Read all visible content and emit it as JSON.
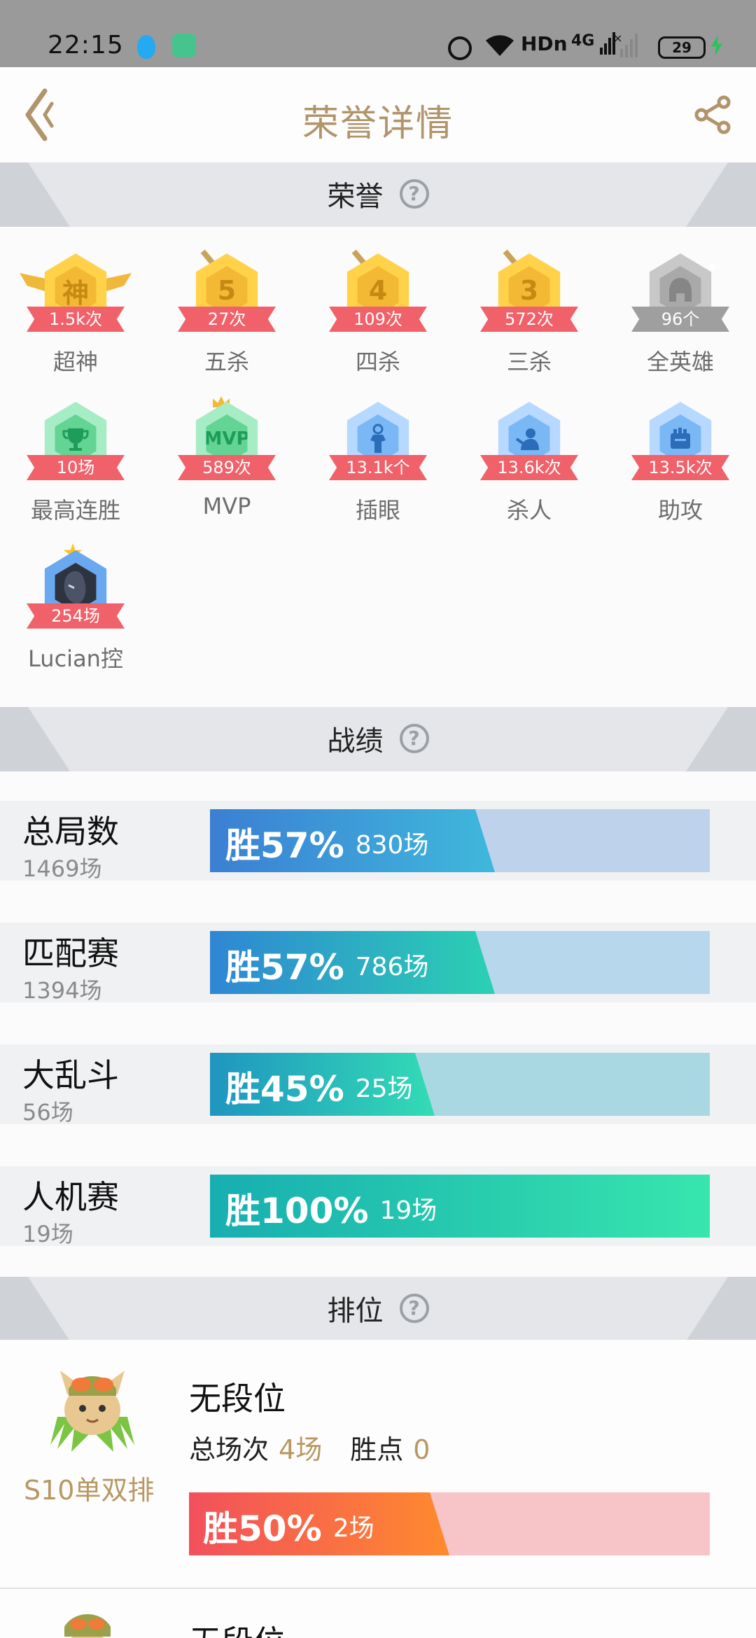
{
  "status_bar": {
    "time": "22:15",
    "icons": [
      "qq-icon",
      "app-icon",
      "alarm-icon",
      "wifi-icon",
      "hd-icon",
      "signal-4g-icon",
      "signal-icon",
      "battery-icon",
      "charging-icon"
    ],
    "hd": "HDn",
    "network": "4G",
    "battery": "29"
  },
  "header": {
    "title": "荣誉详情",
    "back_icon": "chevron-left-icon",
    "share_icon": "share-icon",
    "accent": "#b0946a"
  },
  "honor_section": {
    "title": "荣誉",
    "help": "?",
    "items": [
      {
        "label": "超神",
        "count": "1.5k次",
        "badge_text": "神",
        "style": "gold"
      },
      {
        "label": "五杀",
        "count": "27次",
        "badge_text": "5",
        "style": "gold"
      },
      {
        "label": "四杀",
        "count": "109次",
        "badge_text": "4",
        "style": "gold"
      },
      {
        "label": "三杀",
        "count": "572次",
        "badge_text": "3",
        "style": "gold"
      },
      {
        "label": "全英雄",
        "count": "96个",
        "badge_text": "",
        "style": "grey"
      },
      {
        "label": "最高连胜",
        "count": "10场",
        "badge_text": "",
        "style": "green"
      },
      {
        "label": "MVP",
        "count": "589次",
        "badge_text": "MVP",
        "style": "green"
      },
      {
        "label": "插眼",
        "count": "13.1k个",
        "badge_text": "",
        "style": "blue"
      },
      {
        "label": "杀人",
        "count": "13.6k次",
        "badge_text": "",
        "style": "blue"
      },
      {
        "label": "助攻",
        "count": "13.5k次",
        "badge_text": "",
        "style": "blue"
      },
      {
        "label": "Lucian控",
        "count": "254场",
        "badge_text": "",
        "style": "navy"
      }
    ]
  },
  "record_section": {
    "title": "战绩",
    "help": "?",
    "rows": [
      {
        "name": "总局数",
        "total": "1469场",
        "win_label": "胜57%",
        "win_fraction": 0.57,
        "wins": "830场",
        "fill_from": "#3b7fd3",
        "fill_to": "#3fb8dc",
        "track": "#bfd2ec"
      },
      {
        "name": "匹配赛",
        "total": "1394场",
        "win_label": "胜57%",
        "win_fraction": 0.57,
        "wins": "786场",
        "fill_from": "#2f86d4",
        "fill_to": "#2bd1b2",
        "track": "#b7d8ec"
      },
      {
        "name": "大乱斗",
        "total": "56场",
        "win_label": "胜45%",
        "win_fraction": 0.45,
        "wins": "25场",
        "fill_from": "#1f95c0",
        "fill_to": "#33dcb5",
        "track": "#a9d8e2"
      },
      {
        "name": "人机赛",
        "total": "19场",
        "win_label": "胜100%",
        "win_fraction": 1.0,
        "wins": "19场",
        "fill_from": "#17aeb0",
        "fill_to": "#37e6ad",
        "track": "#bfe9de"
      }
    ]
  },
  "rank_section": {
    "title": "排位",
    "help": "?",
    "entries": [
      {
        "season": "S10单双排",
        "tier": "无段位",
        "games_label": "总场次",
        "games": "4场",
        "points_label": "胜点",
        "points": "0",
        "win_label": "胜50%",
        "win_fraction": 0.5,
        "wins": "2场",
        "fill_from": "#f2505c",
        "fill_to": "#ff8a2e",
        "track": "#f7c4c8"
      },
      {
        "tier": "无段位"
      }
    ]
  }
}
